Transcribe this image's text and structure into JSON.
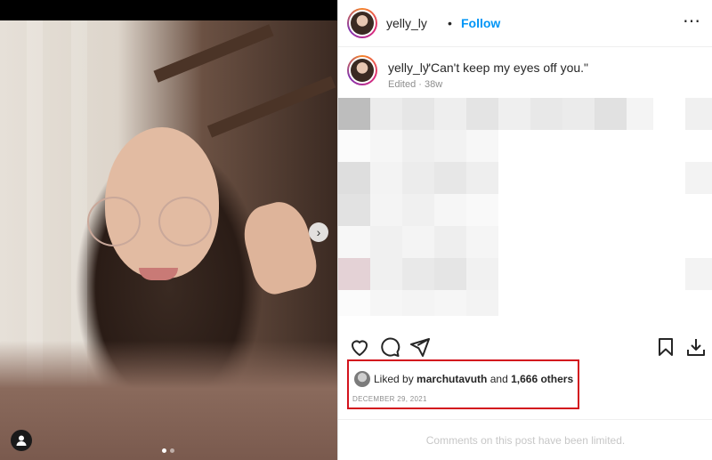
{
  "post": {
    "carousel_dots": 2,
    "active_dot": 0
  },
  "header": {
    "username": "yelly_ly",
    "bullet": "•",
    "follow_label": "Follow",
    "more_label": "⋯"
  },
  "caption": {
    "username": "yelly_ly",
    "text": "\"Can't keep my eyes off you.\"",
    "meta": "Edited · 38w"
  },
  "actions": {
    "like_icon": "heart-icon",
    "comment_icon": "comment-icon",
    "share_icon": "share-icon",
    "save_icon": "bookmark-icon",
    "download_icon": "download-icon"
  },
  "likes": {
    "prefix": "Liked by ",
    "liker": "marchutavuth",
    "middle": " and ",
    "others": "1,666 others",
    "date": "DECEMBER 29, 2021"
  },
  "comments": {
    "limited_text": "Comments on this post have been limited."
  },
  "colors": {
    "follow": "#0095f6",
    "highlight_box": "#d3131d"
  }
}
